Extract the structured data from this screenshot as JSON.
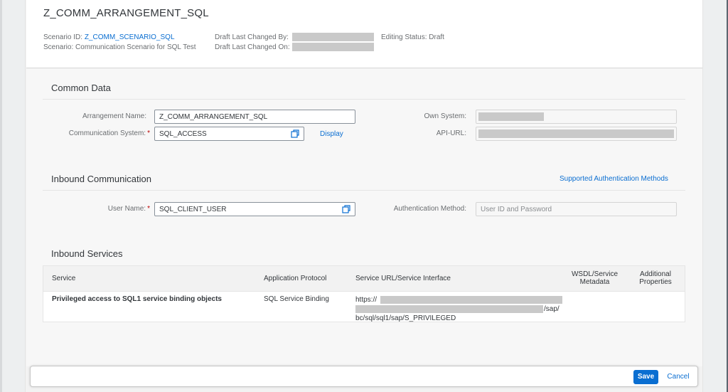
{
  "header": {
    "title": "Z_COMM_ARRANGEMENT_SQL",
    "scenario_id_label": "Scenario ID:",
    "scenario_id_value": "Z_COMM_SCENARIO_SQL",
    "scenario_label": "Scenario:",
    "scenario_value": "Communication Scenario for SQL Test",
    "draft_changed_by_label": "Draft Last Changed By:",
    "draft_changed_on_label": "Draft Last Changed On:",
    "editing_status_label": "Editing Status:",
    "editing_status_value": "Draft"
  },
  "common_data": {
    "title": "Common Data",
    "arrangement_name_label": "Arrangement Name:",
    "arrangement_name_value": "Z_COMM_ARRANGEMENT_SQL",
    "communication_system_label": "Communication System:",
    "communication_system_value": "SQL_ACCESS",
    "display_link": "Display",
    "own_system_label": "Own System:",
    "api_url_label": "API-URL:"
  },
  "inbound_communication": {
    "title": "Inbound Communication",
    "supported_auth_link": "Supported Authentication Methods",
    "user_name_label": "User Name:",
    "user_name_value": "SQL_CLIENT_USER",
    "auth_method_label": "Authentication Method:",
    "auth_method_placeholder": "User ID and Password"
  },
  "inbound_services": {
    "title": "Inbound Services",
    "columns": {
      "service": "Service",
      "protocol": "Application Protocol",
      "url": "Service URL/Service Interface",
      "wsdl_line1": "WSDL/Service",
      "wsdl_line2": "Metadata",
      "additional_line1": "Additional",
      "additional_line2": "Properties"
    },
    "rows": [
      {
        "service": "Privileged access to SQL1 service binding objects",
        "protocol": "SQL Service Binding",
        "url_prefix": "https://",
        "url_mid": "/sap/",
        "url_suffix": "bc/sql/sql1/sap/S_PRIVILEGED"
      }
    ]
  },
  "footer": {
    "save_label": "Save",
    "cancel_label": "Cancel"
  },
  "colors": {
    "accent": "#0a6ed1",
    "required": "#bb0000",
    "redaction": "#c9c9c9"
  }
}
